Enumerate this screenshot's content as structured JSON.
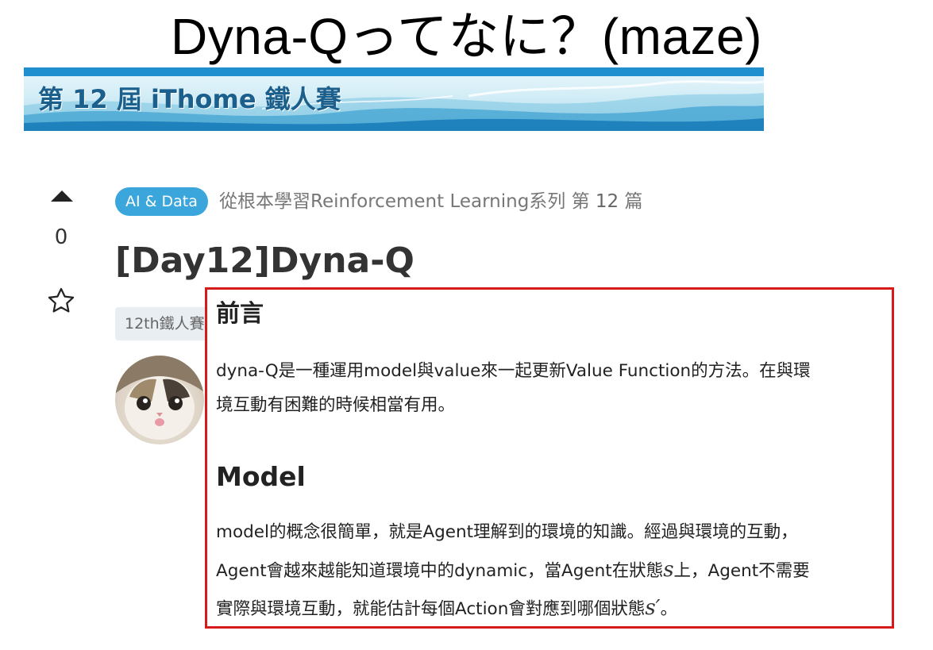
{
  "slide": {
    "title": "Dyna-Qってなに？(maze)"
  },
  "banner": {
    "text": "第 12 屆 iThome 鐵人賽"
  },
  "vote": {
    "count": "0"
  },
  "article": {
    "category_tag": "AI & Data",
    "series_name": "從根本學習Reinforcement Learning",
    "series_suffix": "系列 第",
    "series_number": "12",
    "series_unit": "篇",
    "title": "[Day12]Dyna-Q",
    "chip": "12th鐵人賽"
  },
  "content": {
    "heading1": "前言",
    "intro_line1": "dyna-Q是一種運用model與value來一起更新Value Function的方法。在與環",
    "intro_line2": "境互動有困難的時候相當有用。",
    "heading2": "Model",
    "model_line1": "model的概念很簡單，就是Agent理解到的環境的知識。經過與環境的互動，",
    "model_line2_a": "Agent會越來越能知道環境中的dynamic，當Agent在狀態",
    "model_line2_sym": "s",
    "model_line2_b": "上，Agent不需要",
    "model_line3_a": "實際與環境互動，就能估計每個Action會對應到哪個狀態",
    "model_line3_sym": "s′",
    "model_line3_b": "。"
  },
  "colors": {
    "accent_blue": "#3aa6dc",
    "highlight_border": "#d71a1a",
    "banner_text": "#1b5f8c"
  },
  "icons": [
    "upvote-icon",
    "star-icon",
    "avatar-cat-image"
  ]
}
